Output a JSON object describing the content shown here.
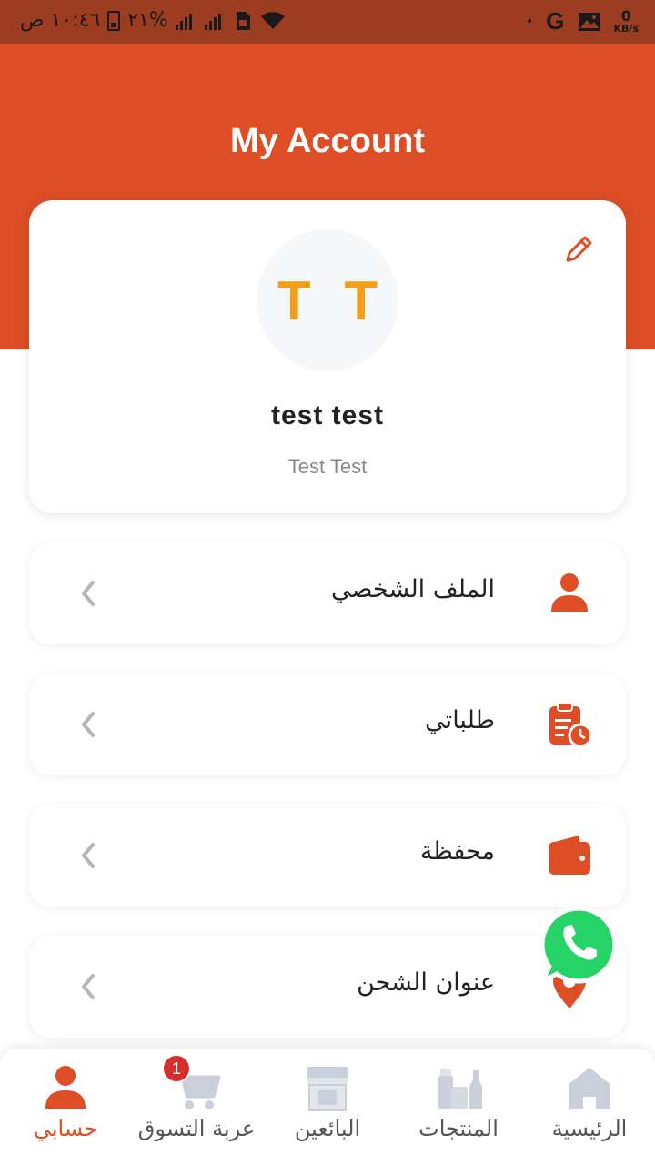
{
  "status_bar": {
    "time": "١٠:٤٦ ص",
    "battery": "٢١%",
    "network_speed_value": "0",
    "network_speed_unit": "KB/s",
    "google_letter": "G"
  },
  "header": {
    "title": "My Account"
  },
  "profile": {
    "initials": "T T",
    "name": "test test",
    "subtitle": "Test Test"
  },
  "menu": [
    {
      "label": "الملف الشخصي",
      "icon": "user-icon"
    },
    {
      "label": "طلباتي",
      "icon": "clipboard-clock-icon"
    },
    {
      "label": "محفظة",
      "icon": "wallet-icon"
    },
    {
      "label": "عنوان الشحن",
      "icon": "location-pin-icon"
    }
  ],
  "bottom_nav": [
    {
      "label": "حسابي",
      "icon": "user-icon",
      "active": true
    },
    {
      "label": "عربة التسوق",
      "icon": "cart-icon",
      "badge": "1"
    },
    {
      "label": "البائعين",
      "icon": "store-icon"
    },
    {
      "label": "المنتجات",
      "icon": "products-icon"
    },
    {
      "label": "الرئيسية",
      "icon": "home-icon"
    }
  ],
  "colors": {
    "accent": "#dd4e26",
    "status_bar": "#9c3c20",
    "avatar_text": "#f2a01c",
    "whatsapp": "#25d366",
    "inactive_icon": "#c9cfdb"
  }
}
